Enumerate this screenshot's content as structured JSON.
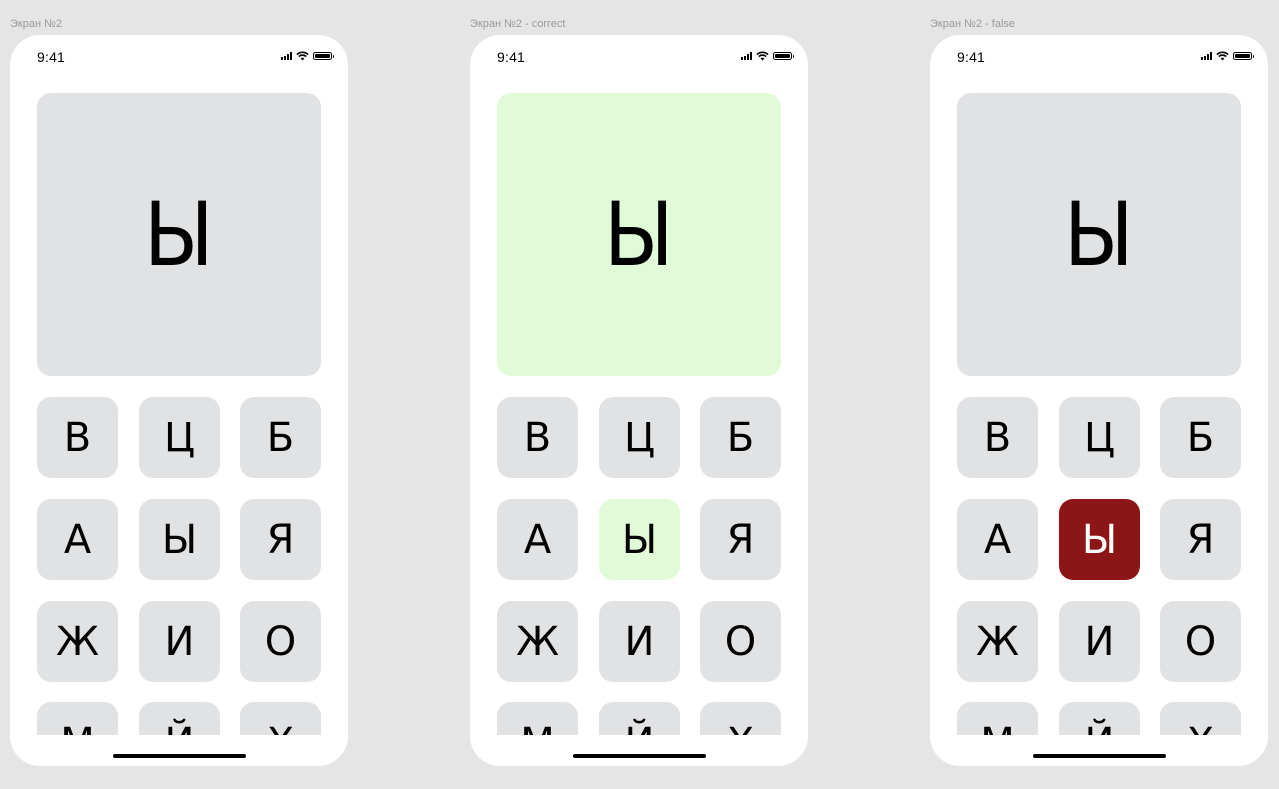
{
  "colors": {
    "canvas": "#e5e5e5",
    "phone": "#ffffff",
    "tile": "#e1e2e4",
    "correct": "#e1fad8",
    "wrong": "#8c1617"
  },
  "screens": [
    {
      "label": "Экран №2",
      "time": "9:41",
      "target_letter": "Ы",
      "card_state": "neutral",
      "selected_key_state": "neutral",
      "keys": [
        "В",
        "Ц",
        "Б",
        "А",
        "Ы",
        "Я",
        "Ж",
        "И",
        "О",
        "М",
        "Й",
        "Х"
      ]
    },
    {
      "label": "Экран №2 - correct",
      "time": "9:41",
      "target_letter": "Ы",
      "card_state": "correct",
      "selected_key_state": "correct",
      "keys": [
        "В",
        "Ц",
        "Б",
        "А",
        "Ы",
        "Я",
        "Ж",
        "И",
        "О",
        "М",
        "Й",
        "Х"
      ]
    },
    {
      "label": "Экран №2 - false",
      "time": "9:41",
      "target_letter": "Ы",
      "card_state": "neutral",
      "selected_key_state": "wrong",
      "keys": [
        "В",
        "Ц",
        "Б",
        "А",
        "Ы",
        "Я",
        "Ж",
        "И",
        "О",
        "М",
        "Й",
        "Х"
      ]
    }
  ]
}
